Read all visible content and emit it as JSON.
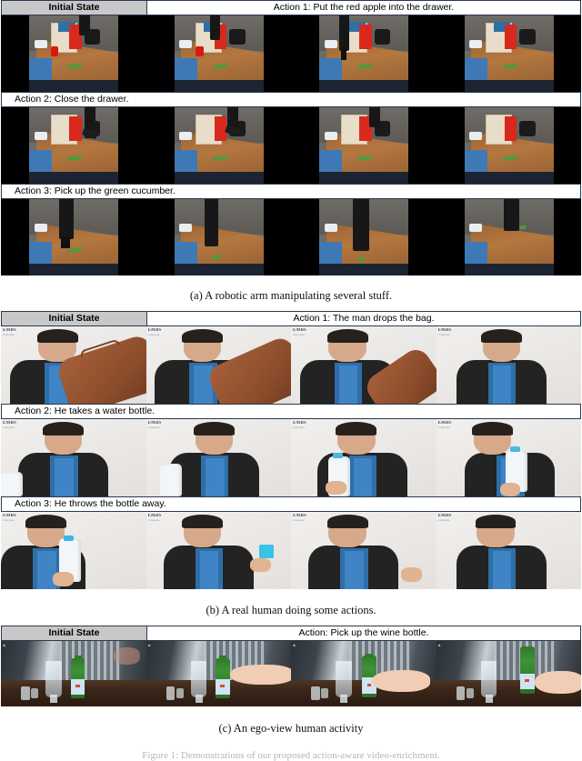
{
  "figure": {
    "number_caption": "Figure 1: Demonstrations of our proposed action-aware video-enrichment.",
    "panels": [
      {
        "id": "a",
        "caption": "(a) A robotic arm manipulating several stuff.",
        "scene": "robot",
        "initial_state_label": "Initial State",
        "rows": [
          {
            "header_style": "split",
            "initial_label": "Initial State",
            "action_label": "Action 1: Put the red apple into the drawer.",
            "frames": [
              "frame-1",
              "frame-2",
              "frame-3",
              "frame-4"
            ]
          },
          {
            "header_style": "full",
            "action_label": "Action 2: Close the drawer.",
            "frames": [
              "frame-1",
              "frame-2",
              "frame-3",
              "frame-4"
            ]
          },
          {
            "header_style": "full",
            "action_label": "Action 3: Pick up the green cucumber.",
            "frames": [
              "frame-1",
              "frame-2",
              "frame-3",
              "frame-4"
            ]
          }
        ]
      },
      {
        "id": "b",
        "caption": "(b) A real human doing some actions.",
        "scene": "human",
        "initial_state_label": "Initial State",
        "rows": [
          {
            "header_style": "split",
            "initial_label": "Initial State",
            "action_label": "Action 1: The man drops the bag.",
            "frames": [
              "frame-1",
              "frame-2",
              "frame-3",
              "frame-4"
            ]
          },
          {
            "header_style": "full",
            "action_label": "Action 2: He takes a water bottle.",
            "frames": [
              "frame-1",
              "frame-2",
              "frame-3",
              "frame-4"
            ]
          },
          {
            "header_style": "full",
            "action_label": "Action 3: He throws the bottle away.",
            "frames": [
              "frame-1",
              "frame-2",
              "frame-3",
              "frame-4"
            ]
          }
        ]
      },
      {
        "id": "c",
        "caption": "(c) An ego-view human activity",
        "scene": "ego",
        "initial_state_label": "Initial State",
        "rows": [
          {
            "header_style": "split",
            "initial_label": "Initial State",
            "action_label": "Action: Pick up the wine bottle.",
            "frames": [
              "frame-1",
              "frame-2",
              "frame-3",
              "frame-4"
            ]
          }
        ]
      }
    ]
  },
  "colors": {
    "header_gray": "#c8c8c8",
    "border": "#2b3a4a",
    "letterbox": "#000000",
    "apple_red": "#d61a12",
    "cucumber_green": "#4e9b3c",
    "bag_brown": "#8c4d2c",
    "bottle_green": "#2f7a2b",
    "bottle_blue": "#4cb7e0"
  }
}
